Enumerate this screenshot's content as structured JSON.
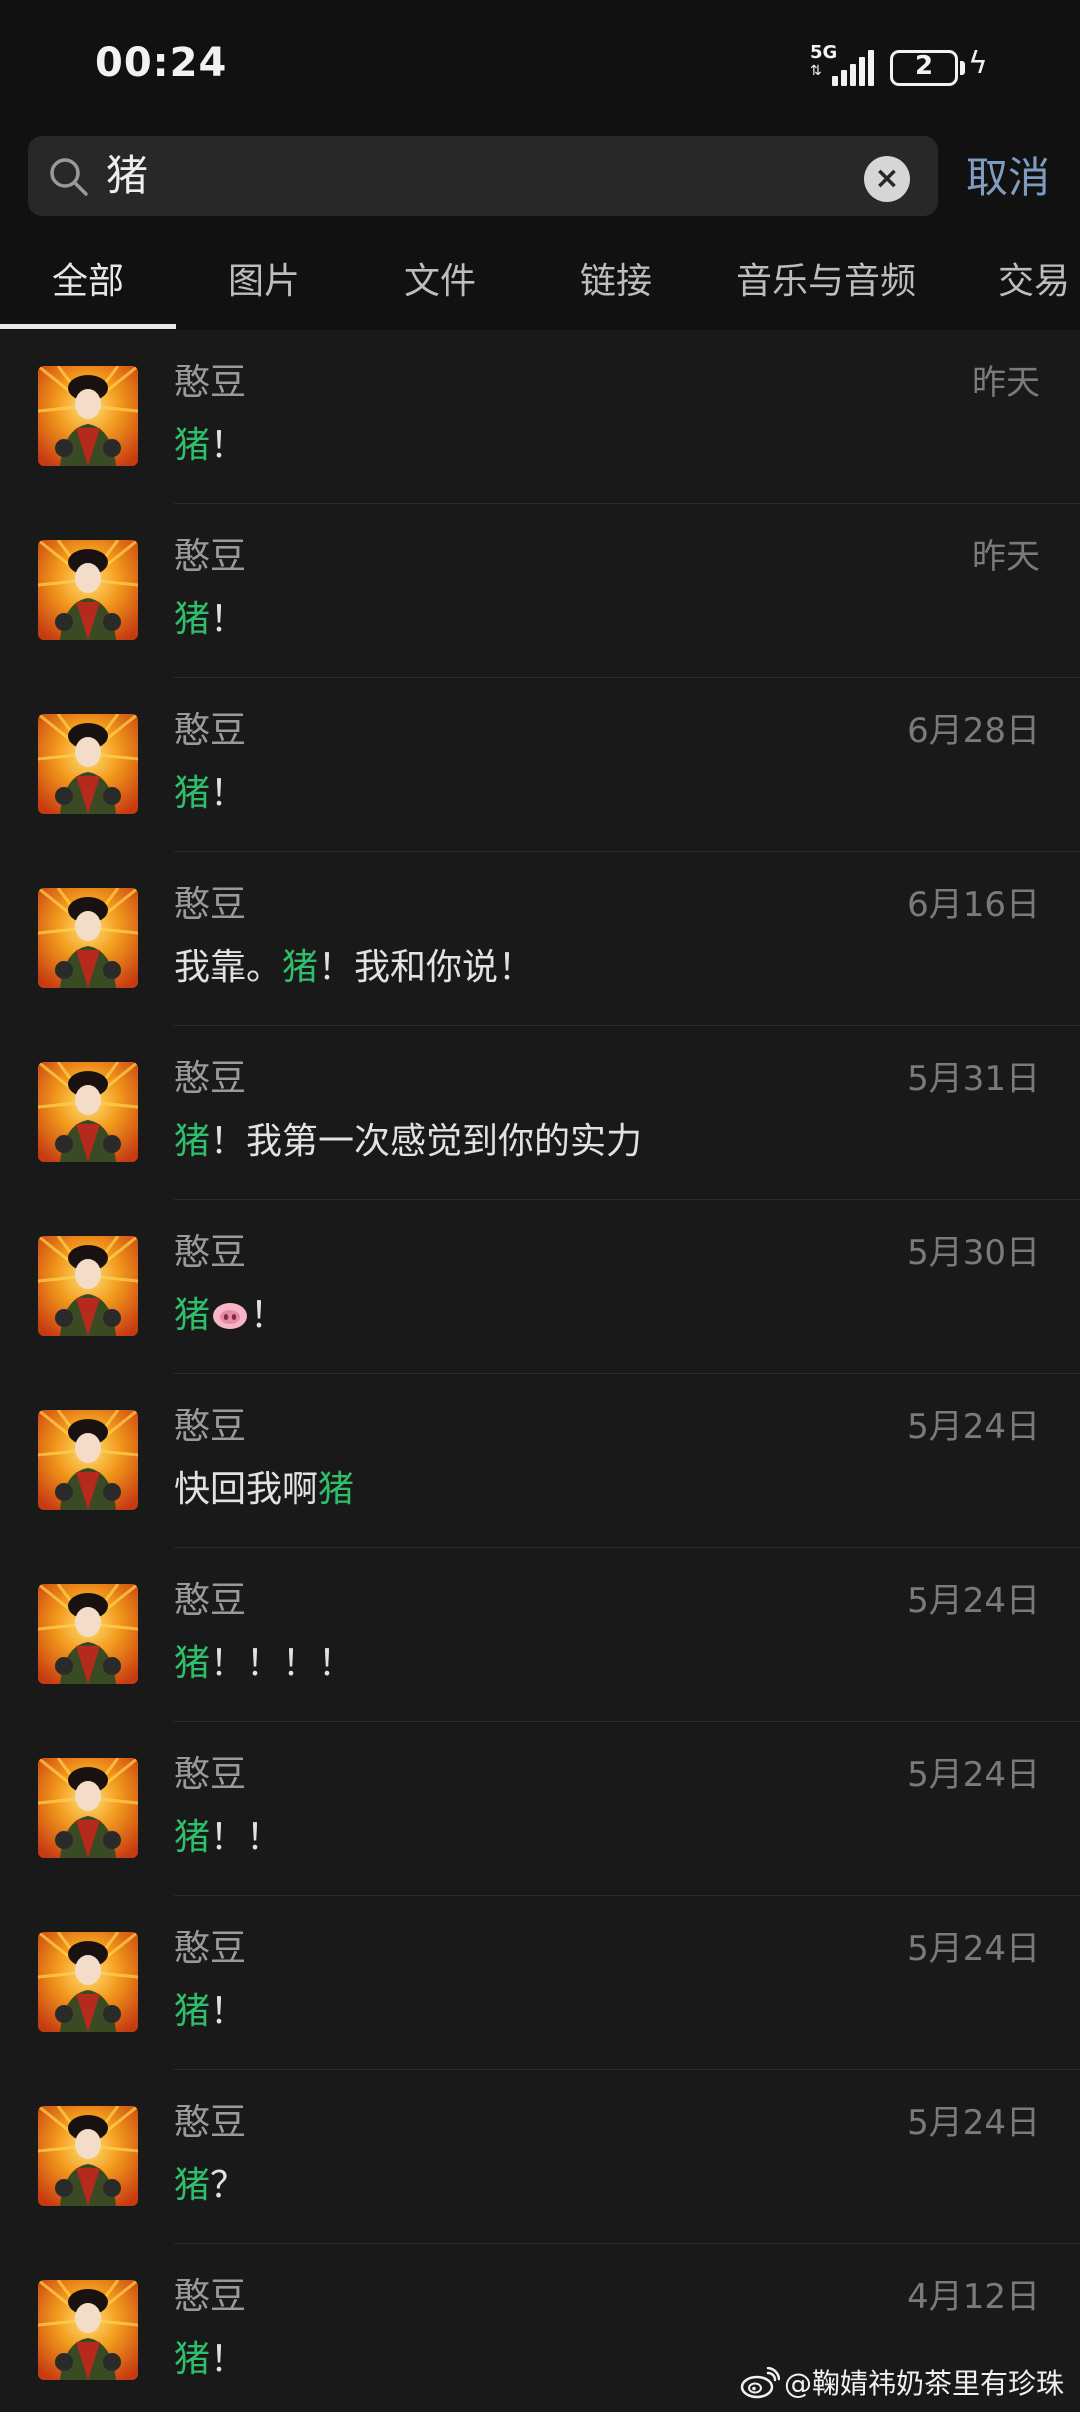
{
  "status_bar": {
    "time": "00:24",
    "network": "5G",
    "battery_level": "2",
    "charging_icon": "lightning-icon"
  },
  "search": {
    "query": "猪",
    "clear_icon": "close-circle-icon",
    "cancel_label": "取消"
  },
  "tabs": [
    {
      "label": "全部",
      "active": true
    },
    {
      "label": "图片",
      "active": false
    },
    {
      "label": "文件",
      "active": false
    },
    {
      "label": "链接",
      "active": false
    },
    {
      "label": "音乐与音频",
      "active": false
    },
    {
      "label": "交易",
      "active": false
    }
  ],
  "results": [
    {
      "name": "憨豆",
      "date": "昨天",
      "message": [
        "猪",
        "！"
      ]
    },
    {
      "name": "憨豆",
      "date": "昨天",
      "message": [
        "猪",
        "！"
      ]
    },
    {
      "name": "憨豆",
      "date": "6月28日",
      "message": [
        "猪",
        "！"
      ]
    },
    {
      "name": "憨豆",
      "date": "6月16日",
      "message": [
        "我靠。",
        "猪",
        "！我和你说！"
      ]
    },
    {
      "name": "憨豆",
      "date": "5月31日",
      "message": [
        "猪",
        "！我第一次感觉到你的实力"
      ]
    },
    {
      "name": "憨豆",
      "date": "5月30日",
      "message": [
        "猪",
        "[pig-face]",
        "！"
      ]
    },
    {
      "name": "憨豆",
      "date": "5月24日",
      "message": [
        "快回我啊",
        "猪"
      ]
    },
    {
      "name": "憨豆",
      "date": "5月24日",
      "message": [
        "猪",
        "！！！！"
      ]
    },
    {
      "name": "憨豆",
      "date": "5月24日",
      "message": [
        "猪",
        "！！"
      ]
    },
    {
      "name": "憨豆",
      "date": "5月24日",
      "message": [
        "猪",
        "！"
      ]
    },
    {
      "name": "憨豆",
      "date": "5月24日",
      "message": [
        "猪",
        "？"
      ]
    },
    {
      "name": "憨豆",
      "date": "4月12日",
      "message": [
        "猪",
        "！"
      ]
    }
  ],
  "highlight_color": "#2fbf6a",
  "watermark": "@鞠婧祎奶茶里有珍珠"
}
